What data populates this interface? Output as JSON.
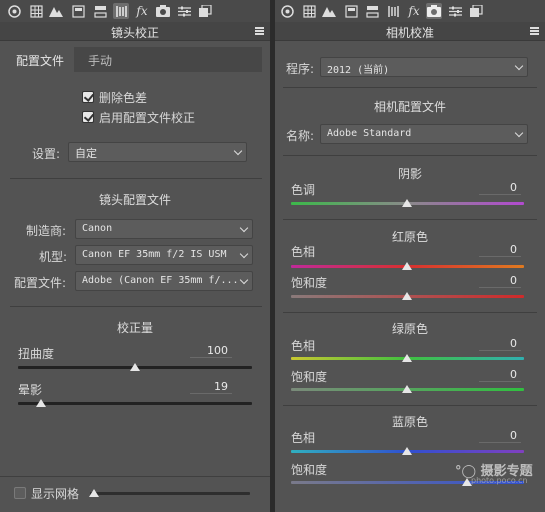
{
  "toolbar_icons": [
    "aperture-icon",
    "grid-icon",
    "mountain-icon",
    "panel-icon",
    "split-toning-icon",
    "lens-icon",
    "fx-icon",
    "camera-icon",
    "sliders-icon",
    "presets-icon"
  ],
  "left": {
    "title": "镜头校正",
    "tabs": [
      "配置文件",
      "手动"
    ],
    "checkbox_remove_ca": "删除色差",
    "checkbox_enable_profile": "启用配置文件校正",
    "setup_label": "设置:",
    "setup_value": "自定",
    "lens_profile_title": "镜头配置文件",
    "make_label": "制造商:",
    "make_value": "Canon",
    "model_label": "机型:",
    "model_value": "Canon EF 35mm f/2 IS USM",
    "profile_label": "配置文件:",
    "profile_value": "Adobe (Canon EF 35mm f/...",
    "correction_title": "校正量",
    "distortion_label": "扭曲度",
    "distortion_value": "100",
    "vignetting_label": "晕影",
    "vignetting_value": "19",
    "show_grid_label": "显示网格"
  },
  "right": {
    "title": "相机校准",
    "process_label": "程序:",
    "process_value": "2012 (当前)",
    "camera_profile_title": "相机配置文件",
    "name_label": "名称:",
    "name_value": "Adobe Standard",
    "shadows_title": "阴影",
    "tint_label": "色调",
    "tint_value": "0",
    "red_title": "红原色",
    "red_hue_label": "色相",
    "red_hue_value": "0",
    "red_sat_label": "饱和度",
    "red_sat_value": "0",
    "green_title": "绿原色",
    "green_hue_label": "色相",
    "green_hue_value": "0",
    "green_sat_label": "饱和度",
    "green_sat_value": "0",
    "blue_title": "蓝原色",
    "blue_hue_label": "色相",
    "blue_hue_value": "0",
    "blue_sat_label": "饱和度"
  },
  "watermark": {
    "brand": "摄影专题",
    "url": "photo.poco.cn"
  },
  "colors": {
    "panel_bg": "#535353",
    "text": "#d6d6d6"
  }
}
